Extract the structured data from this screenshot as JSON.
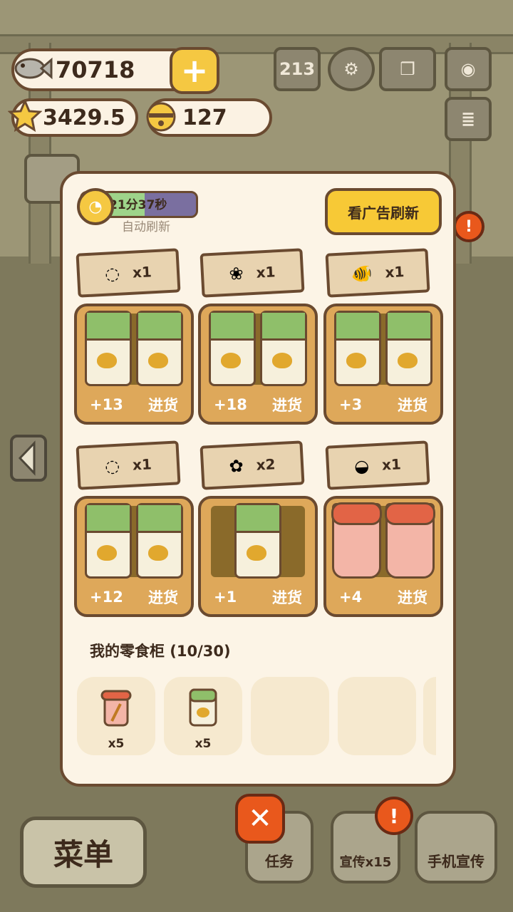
{
  "currency": {
    "fish": "70718",
    "stars": "3429.5",
    "bells": "127"
  },
  "top_icons": [
    "ranking-icon",
    "settings-gear-icon",
    "cat-book-icon",
    "camera-icon",
    "notice-card-icon"
  ],
  "panel": {
    "timer_text": "21分37秒",
    "timer_progress": 0.55,
    "auto_refresh_label": "自动刷新",
    "ad_refresh_label": "看广告刷新",
    "restock_label": "进货",
    "items": [
      {
        "icon": "banana-chips-icon",
        "glyph": "◌",
        "qty": "x1",
        "stock": "+13",
        "kind": "can"
      },
      {
        "icon": "popcorn-icon",
        "glyph": "❀",
        "qty": "x1",
        "stock": "+18",
        "kind": "can"
      },
      {
        "icon": "clownfish-icon",
        "glyph": "🐠",
        "qty": "x1",
        "stock": "+3",
        "kind": "can"
      },
      {
        "icon": "banana-chips-icon",
        "glyph": "◌",
        "qty": "x1",
        "stock": "+12",
        "kind": "can"
      },
      {
        "icon": "flower-icon",
        "glyph": "✿",
        "qty": "x2",
        "stock": "+1",
        "kind": "can-single"
      },
      {
        "icon": "grain-sack-icon",
        "glyph": "◒",
        "qty": "x1",
        "stock": "+4",
        "kind": "cup"
      }
    ],
    "inventory_title": "我的零食柜 (10/30)",
    "inventory_slots": [
      {
        "icon": "noodle-cup-icon",
        "qty": "x5"
      },
      {
        "icon": "bear-can-icon",
        "qty": "x5"
      },
      {
        "icon": "",
        "qty": ""
      },
      {
        "icon": "",
        "qty": ""
      }
    ]
  },
  "bottom": {
    "menu_label": "菜单",
    "tasks_label": "任务",
    "promo_label": "宣传x15",
    "phone_promo_label": "手机宣传"
  }
}
